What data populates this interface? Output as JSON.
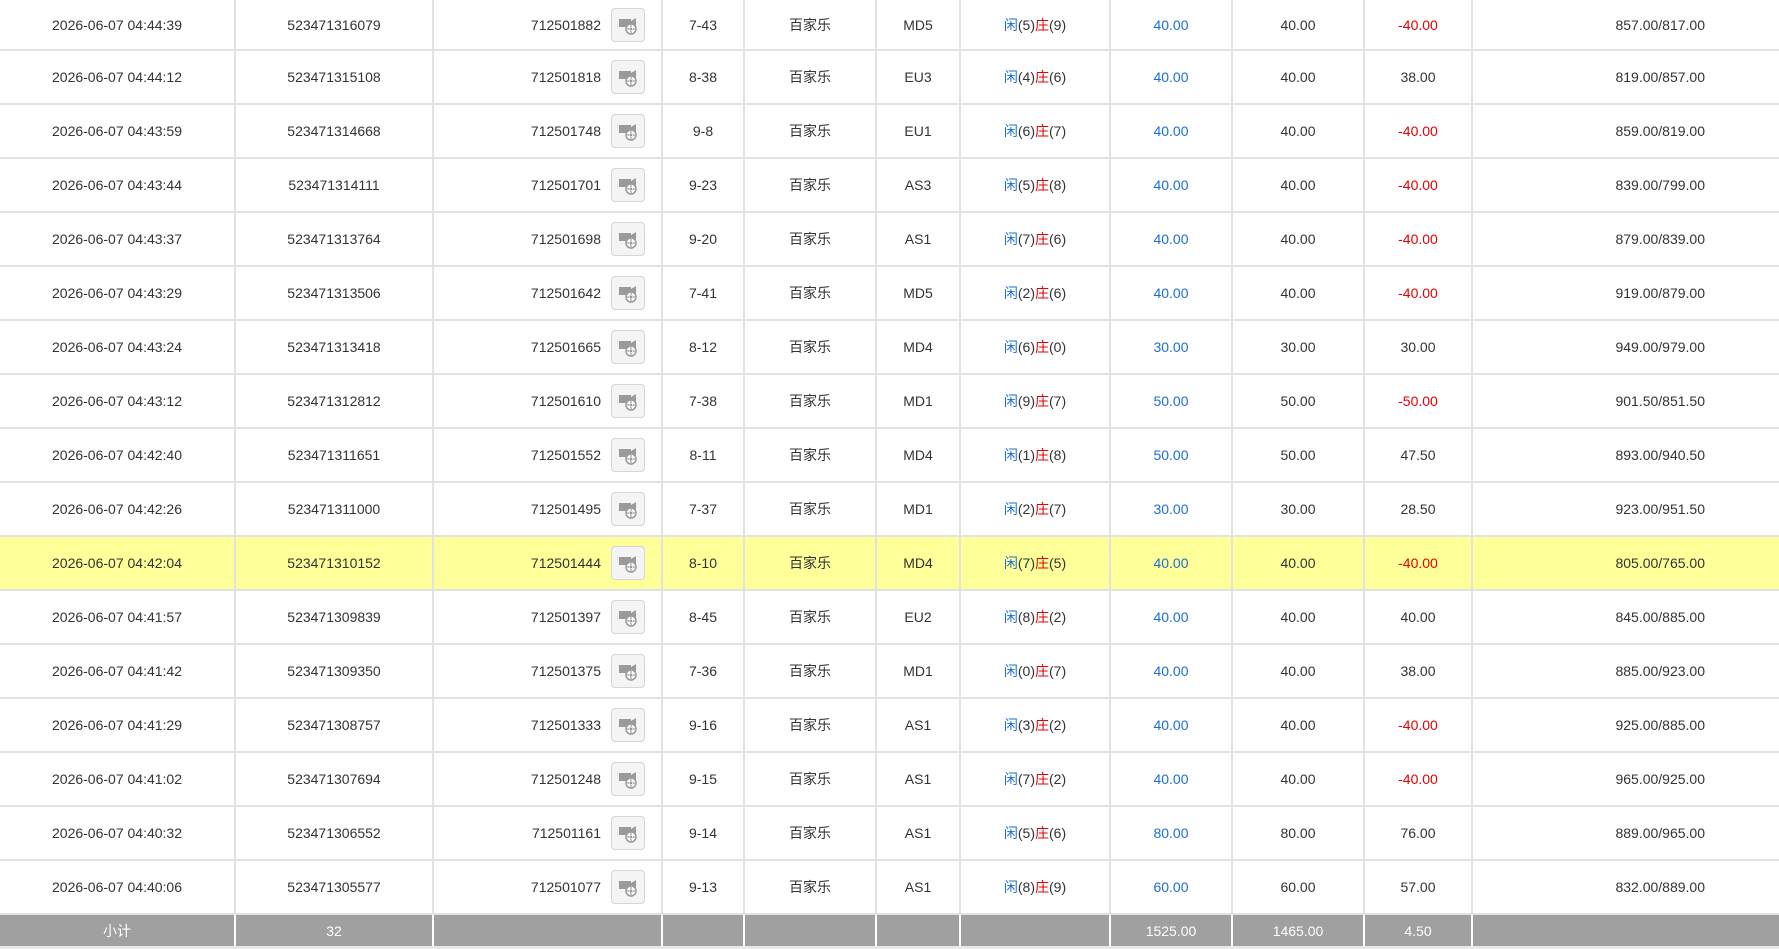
{
  "colors": {
    "accent_blue": "#1a6fd6",
    "loss_red": "#e60000",
    "highlight_row": "#ffff99",
    "total_bar": "#a0a0a0"
  },
  "labels": {
    "player": "闲",
    "banker": "庄"
  },
  "rows": [
    {
      "time": "2026-06-07 04:44:39",
      "order_id": "523471316079",
      "round_id": "712501882",
      "shoe": "7-43",
      "game": "百家乐",
      "table": "MD5",
      "player": "(5)",
      "banker": "(9)",
      "bet": "40.00",
      "valid": "40.00",
      "win": "-40.00",
      "balance": "857.00/817.00"
    },
    {
      "time": "2026-06-07 04:44:12",
      "order_id": "523471315108",
      "round_id": "712501818",
      "shoe": "8-38",
      "game": "百家乐",
      "table": "EU3",
      "player": "(4)",
      "banker": "(6)",
      "bet": "40.00",
      "valid": "40.00",
      "win": "38.00",
      "balance": "819.00/857.00"
    },
    {
      "time": "2026-06-07 04:43:59",
      "order_id": "523471314668",
      "round_id": "712501748",
      "shoe": "9-8",
      "game": "百家乐",
      "table": "EU1",
      "player": "(6)",
      "banker": "(7)",
      "bet": "40.00",
      "valid": "40.00",
      "win": "-40.00",
      "balance": "859.00/819.00"
    },
    {
      "time": "2026-06-07 04:43:44",
      "order_id": "523471314111",
      "round_id": "712501701",
      "shoe": "9-23",
      "game": "百家乐",
      "table": "AS3",
      "player": "(5)",
      "banker": "(8)",
      "bet": "40.00",
      "valid": "40.00",
      "win": "-40.00",
      "balance": "839.00/799.00"
    },
    {
      "time": "2026-06-07 04:43:37",
      "order_id": "523471313764",
      "round_id": "712501698",
      "shoe": "9-20",
      "game": "百家乐",
      "table": "AS1",
      "player": "(7)",
      "banker": "(6)",
      "bet": "40.00",
      "valid": "40.00",
      "win": "-40.00",
      "balance": "879.00/839.00"
    },
    {
      "time": "2026-06-07 04:43:29",
      "order_id": "523471313506",
      "round_id": "712501642",
      "shoe": "7-41",
      "game": "百家乐",
      "table": "MD5",
      "player": "(2)",
      "banker": "(6)",
      "bet": "40.00",
      "valid": "40.00",
      "win": "-40.00",
      "balance": "919.00/879.00"
    },
    {
      "time": "2026-06-07 04:43:24",
      "order_id": "523471313418",
      "round_id": "712501665",
      "shoe": "8-12",
      "game": "百家乐",
      "table": "MD4",
      "player": "(6)",
      "banker": "(0)",
      "bet": "30.00",
      "valid": "30.00",
      "win": "30.00",
      "balance": "949.00/979.00"
    },
    {
      "time": "2026-06-07 04:43:12",
      "order_id": "523471312812",
      "round_id": "712501610",
      "shoe": "7-38",
      "game": "百家乐",
      "table": "MD1",
      "player": "(9)",
      "banker": "(7)",
      "bet": "50.00",
      "valid": "50.00",
      "win": "-50.00",
      "balance": "901.50/851.50"
    },
    {
      "time": "2026-06-07 04:42:40",
      "order_id": "523471311651",
      "round_id": "712501552",
      "shoe": "8-11",
      "game": "百家乐",
      "table": "MD4",
      "player": "(1)",
      "banker": "(8)",
      "bet": "50.00",
      "valid": "50.00",
      "win": "47.50",
      "balance": "893.00/940.50"
    },
    {
      "time": "2026-06-07 04:42:26",
      "order_id": "523471311000",
      "round_id": "712501495",
      "shoe": "7-37",
      "game": "百家乐",
      "table": "MD1",
      "player": "(2)",
      "banker": "(7)",
      "bet": "30.00",
      "valid": "30.00",
      "win": "28.50",
      "balance": "923.00/951.50"
    },
    {
      "time": "2026-06-07 04:42:04",
      "order_id": "523471310152",
      "round_id": "712501444",
      "shoe": "8-10",
      "game": "百家乐",
      "table": "MD4",
      "player": "(7)",
      "banker": "(5)",
      "bet": "40.00",
      "valid": "40.00",
      "win": "-40.00",
      "balance": "805.00/765.00",
      "highlight": true
    },
    {
      "time": "2026-06-07 04:41:57",
      "order_id": "523471309839",
      "round_id": "712501397",
      "shoe": "8-45",
      "game": "百家乐",
      "table": "EU2",
      "player": "(8)",
      "banker": "(2)",
      "bet": "40.00",
      "valid": "40.00",
      "win": "40.00",
      "balance": "845.00/885.00"
    },
    {
      "time": "2026-06-07 04:41:42",
      "order_id": "523471309350",
      "round_id": "712501375",
      "shoe": "7-36",
      "game": "百家乐",
      "table": "MD1",
      "player": "(0)",
      "banker": "(7)",
      "bet": "40.00",
      "valid": "40.00",
      "win": "38.00",
      "balance": "885.00/923.00"
    },
    {
      "time": "2026-06-07 04:41:29",
      "order_id": "523471308757",
      "round_id": "712501333",
      "shoe": "9-16",
      "game": "百家乐",
      "table": "AS1",
      "player": "(3)",
      "banker": "(2)",
      "bet": "40.00",
      "valid": "40.00",
      "win": "-40.00",
      "balance": "925.00/885.00"
    },
    {
      "time": "2026-06-07 04:41:02",
      "order_id": "523471307694",
      "round_id": "712501248",
      "shoe": "9-15",
      "game": "百家乐",
      "table": "AS1",
      "player": "(7)",
      "banker": "(2)",
      "bet": "40.00",
      "valid": "40.00",
      "win": "-40.00",
      "balance": "965.00/925.00"
    },
    {
      "time": "2026-06-07 04:40:32",
      "order_id": "523471306552",
      "round_id": "712501161",
      "shoe": "9-14",
      "game": "百家乐",
      "table": "AS1",
      "player": "(5)",
      "banker": "(6)",
      "bet": "80.00",
      "valid": "80.00",
      "win": "76.00",
      "balance": "889.00/965.00"
    },
    {
      "time": "2026-06-07 04:40:06",
      "order_id": "523471305577",
      "round_id": "712501077",
      "shoe": "9-13",
      "game": "百家乐",
      "table": "AS1",
      "player": "(8)",
      "banker": "(9)",
      "bet": "60.00",
      "valid": "60.00",
      "win": "57.00",
      "balance": "832.00/889.00"
    }
  ],
  "totals": {
    "label": "小计",
    "count": "32",
    "bet": "1525.00",
    "valid": "1465.00",
    "win": "4.50"
  },
  "icons": {
    "replay": "video-replay-icon"
  }
}
